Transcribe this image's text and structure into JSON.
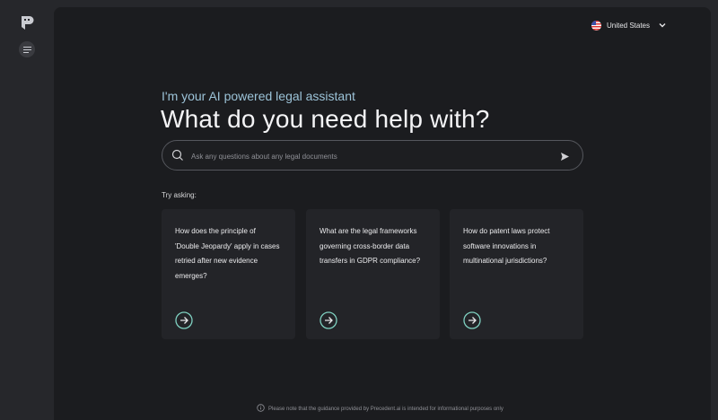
{
  "sidebar": {
    "logo_icon": "precedent-logo-icon",
    "menu_icon": "menu-lines-icon"
  },
  "header": {
    "region_label": "United States",
    "flag_icon": "us-flag-icon",
    "dropdown_icon": "chevron-down-icon"
  },
  "hero": {
    "subtitle": "I'm your AI powered legal assistant",
    "title": "What do you need help with?"
  },
  "search": {
    "placeholder": "Ask any questions about any legal documents",
    "value": "",
    "search_icon": "search-icon",
    "send_icon": "send-icon"
  },
  "suggestions": {
    "label": "Try asking:",
    "items": [
      {
        "text": "How does the principle of 'Double Jeopardy' apply in cases retried after new evidence emerges?",
        "icon": "arrow-right-circle-icon"
      },
      {
        "text": "What are the legal frameworks governing cross-border data transfers in GDPR compliance?",
        "icon": "arrow-right-circle-icon"
      },
      {
        "text": "How do patent laws protect software innovations in multinational jurisdictions?",
        "icon": "arrow-right-circle-icon"
      }
    ]
  },
  "footer": {
    "info_icon": "info-icon",
    "notice": "Please note that the guidance provided by Precedent.ai is intended for informational purposes only"
  },
  "colors": {
    "accent": "#9cc3d8",
    "arrow": "#7fd0c0",
    "background": "#1b1c1f",
    "card": "#232428"
  }
}
